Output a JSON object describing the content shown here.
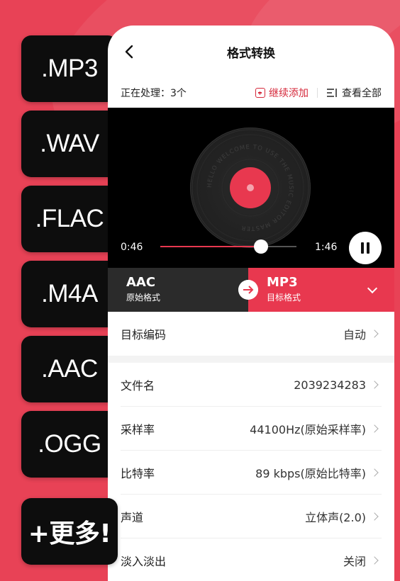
{
  "formats": [
    ".MP3",
    ".WAV",
    ".FLAC",
    ".M4A",
    ".AAC",
    ".OGG"
  ],
  "more_label": "+更多!",
  "nav": {
    "title": "格式转换"
  },
  "status": {
    "processing": "正在处理：3个",
    "add_label": "继续添加",
    "view_all_label": "查看全部"
  },
  "player": {
    "current_time": "0:46",
    "duration": "1:46",
    "progress": 0.74,
    "vinyl_text": "HELLO WELCOME TO USE THE MUSIC EDITOR MASTER"
  },
  "conversion": {
    "source_format": "AAC",
    "source_label": "原始格式",
    "target_format": "MP3",
    "target_label": "目标格式"
  },
  "settings": {
    "encoding": {
      "label": "目标编码",
      "value": "自动"
    },
    "items": [
      {
        "label": "文件名",
        "value": "2039234283"
      },
      {
        "label": "采样率",
        "value": "44100Hz(原始采样率)"
      },
      {
        "label": "比特率",
        "value": "89 kbps(原始比特率)"
      },
      {
        "label": "声道",
        "value": "立体声(2.0)"
      },
      {
        "label": "淡入淡出",
        "value": "关闭"
      }
    ]
  },
  "colors": {
    "accent": "#e8384f",
    "background": "#e84256",
    "chip": "#0d0d0d",
    "source_bar": "#2b2b2b"
  }
}
